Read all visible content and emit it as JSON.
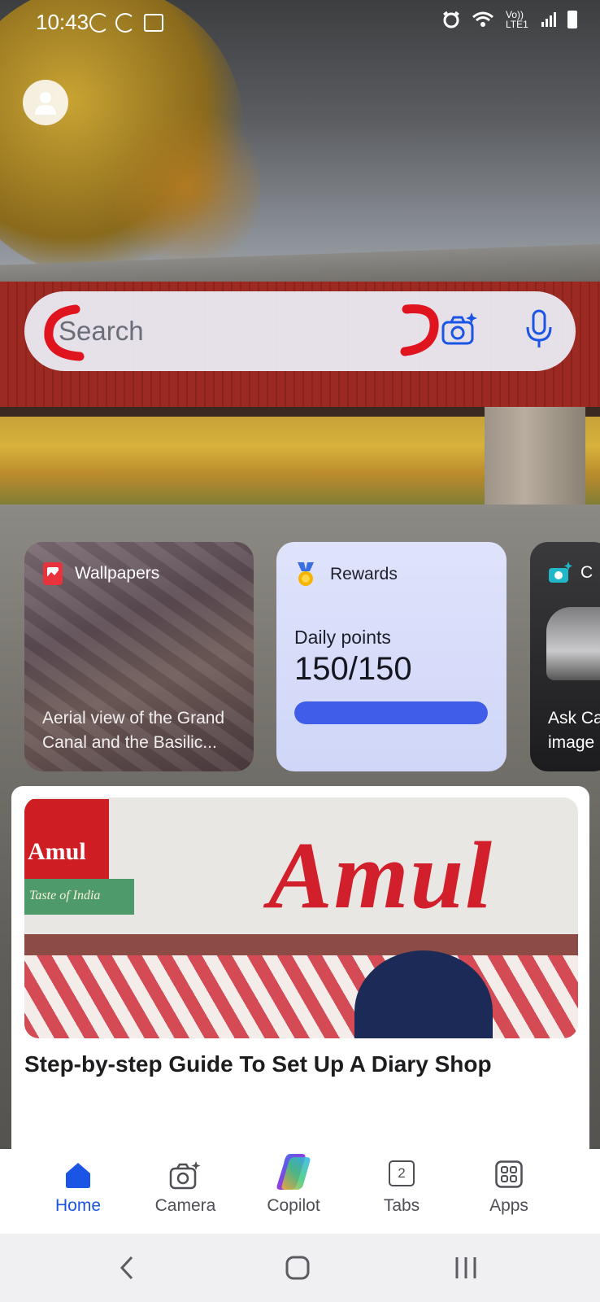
{
  "status_bar": {
    "time": "10:43",
    "network": "Vo)) LTE1"
  },
  "search": {
    "placeholder": "Search"
  },
  "cards": {
    "wallpapers": {
      "title": "Wallpapers",
      "caption": "Aerial view of the Grand Canal and the Basilic..."
    },
    "rewards": {
      "title": "Rewards",
      "label": "Daily points",
      "value": "150/150",
      "progress_fraction": 1.0
    },
    "ask": {
      "title": "C",
      "caption_line1": "Ask Ca",
      "caption_line2": "image"
    }
  },
  "news": {
    "image_sign_left": "Amul",
    "image_sign_sub": "Taste of India",
    "image_sign_big": "Amul",
    "title": "Step-by-step Guide To Set Up A Diary Shop"
  },
  "bottom_nav": {
    "home": "Home",
    "camera": "Camera",
    "copilot": "Copilot",
    "tabs": "Tabs",
    "tabs_count": "2",
    "apps": "Apps"
  },
  "colors": {
    "accent": "#1a55e6",
    "rewards_progress": "#3f5de8",
    "annotation_red": "#e0141e"
  }
}
